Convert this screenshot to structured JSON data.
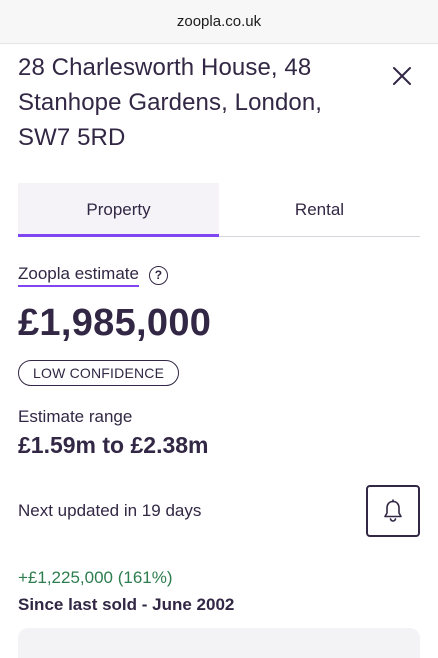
{
  "browser": {
    "url": "zoopla.co.uk"
  },
  "property": {
    "address_lines": [
      "28 Charlesworth House, 48",
      "Stanhope Gardens, London,",
      "SW7 5RD"
    ]
  },
  "tabs": [
    {
      "label": "Property",
      "active": true
    },
    {
      "label": "Rental",
      "active": false
    }
  ],
  "estimate": {
    "link_label": "Zoopla estimate",
    "help_glyph": "?",
    "price": "£1,985,000",
    "confidence_badge": "LOW CONFIDENCE",
    "range_label": "Estimate range",
    "range_value": "£1.59m to £2.38m",
    "next_updated": "Next updated in 19 days"
  },
  "history": {
    "change": "+£1,225,000 (161%)",
    "since": "Since last sold - June 2002"
  },
  "icons": {
    "close": "close-icon",
    "help": "help-circle-icon",
    "bell": "bell-icon"
  },
  "colors": {
    "text": "#322744",
    "accent": "#8046f1",
    "positive": "#2e7d4f",
    "tab_active_bg": "#f5f3f8"
  }
}
